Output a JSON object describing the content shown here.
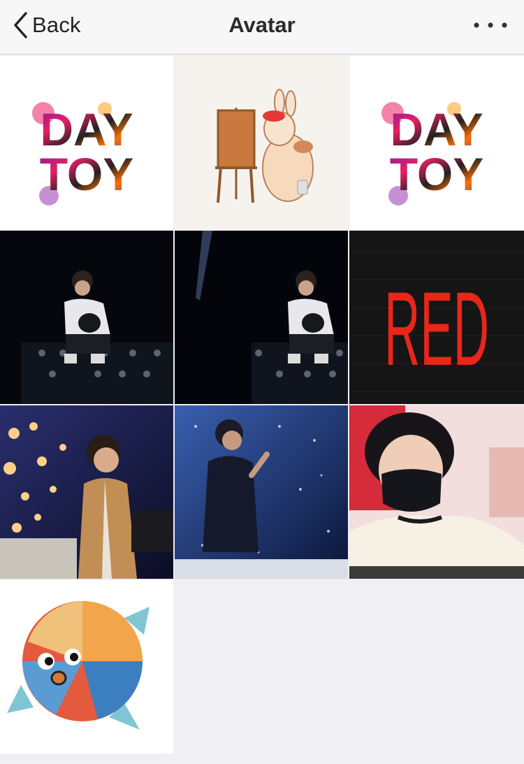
{
  "navbar": {
    "back_label": "Back",
    "title": "Avatar",
    "more_icon": "ellipsis-icon",
    "back_icon": "chevron-left-icon"
  },
  "avatars": [
    {
      "kind": "daytoy-logo",
      "text_line1": "DAY",
      "text_line2": "TOY"
    },
    {
      "kind": "bunny-painter-illustration"
    },
    {
      "kind": "daytoy-logo",
      "text_line1": "DAY",
      "text_line2": "TOY"
    },
    {
      "kind": "stage-photo-seated"
    },
    {
      "kind": "stage-photo-seated-spotlight"
    },
    {
      "kind": "red-text-logo",
      "text": "RED"
    },
    {
      "kind": "stage-photo-coat"
    },
    {
      "kind": "stage-photo-singing"
    },
    {
      "kind": "selfie-mask-photo"
    },
    {
      "kind": "pufferfish-illustration"
    }
  ],
  "colors": {
    "background": "#efeff4",
    "navbar": "#f7f7f8",
    "red_logo": "#e8261a"
  }
}
